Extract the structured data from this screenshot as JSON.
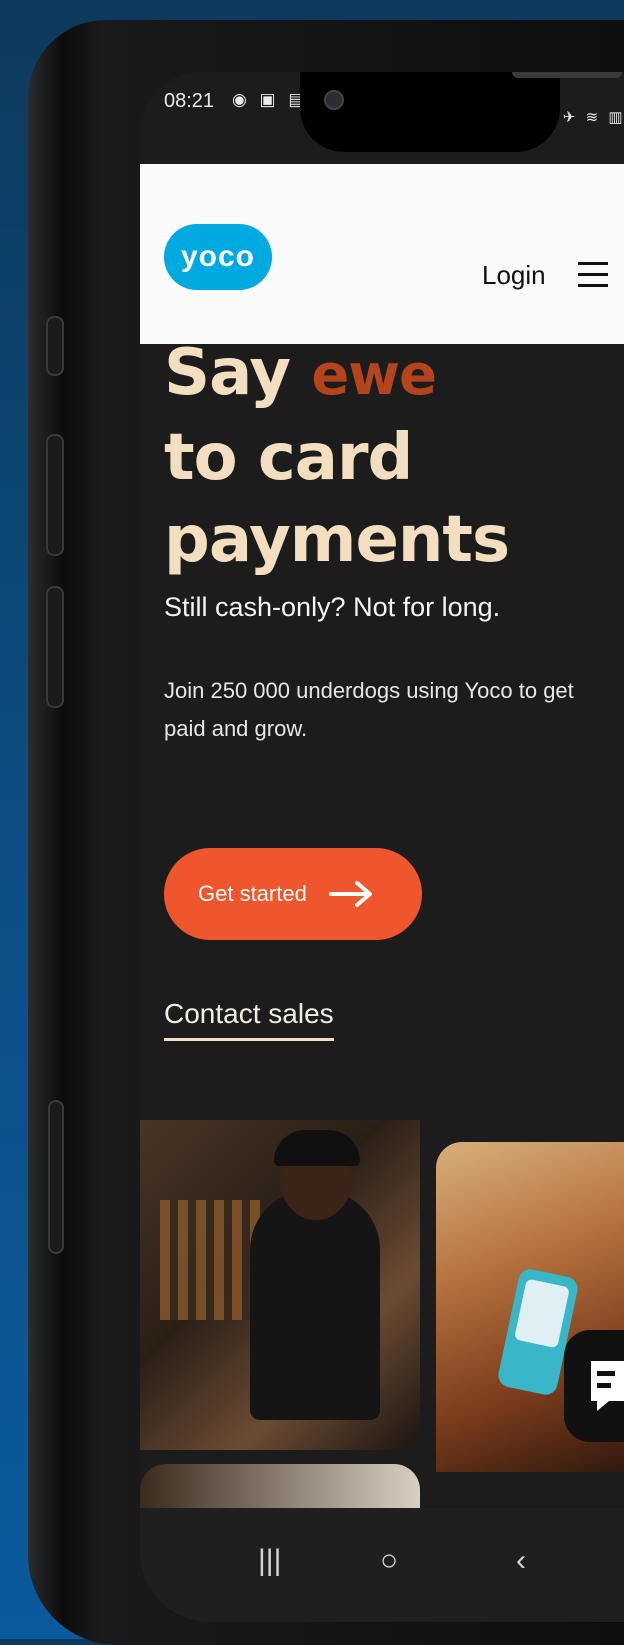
{
  "status_bar": {
    "time": "08:21",
    "left_icons": "◉ ▣ ▤",
    "right_icons": "⏰ ✈ ≋ ▥ ▮"
  },
  "header": {
    "logo_text": "yoco",
    "login_label": "Login"
  },
  "hero": {
    "headline_word1": "Say",
    "headline_accent": "ewe",
    "headline_line2": "to card",
    "headline_line3": "payments",
    "subheading": "Still cash-only? Not for long.",
    "description": "Join 250 000 underdogs using Yoco to get paid and grow."
  },
  "actions": {
    "get_started_label": "Get started",
    "contact_sales_label": "Contact sales"
  },
  "nav_bar": {
    "recent": "|||",
    "home": "○",
    "back": "‹"
  },
  "colors": {
    "brand_blue": "#00a9e0",
    "cta_orange": "#f0562d",
    "accent_rust": "#b5441d",
    "headline_cream": "#f3dfc0",
    "page_dark": "#1c1c1d"
  }
}
